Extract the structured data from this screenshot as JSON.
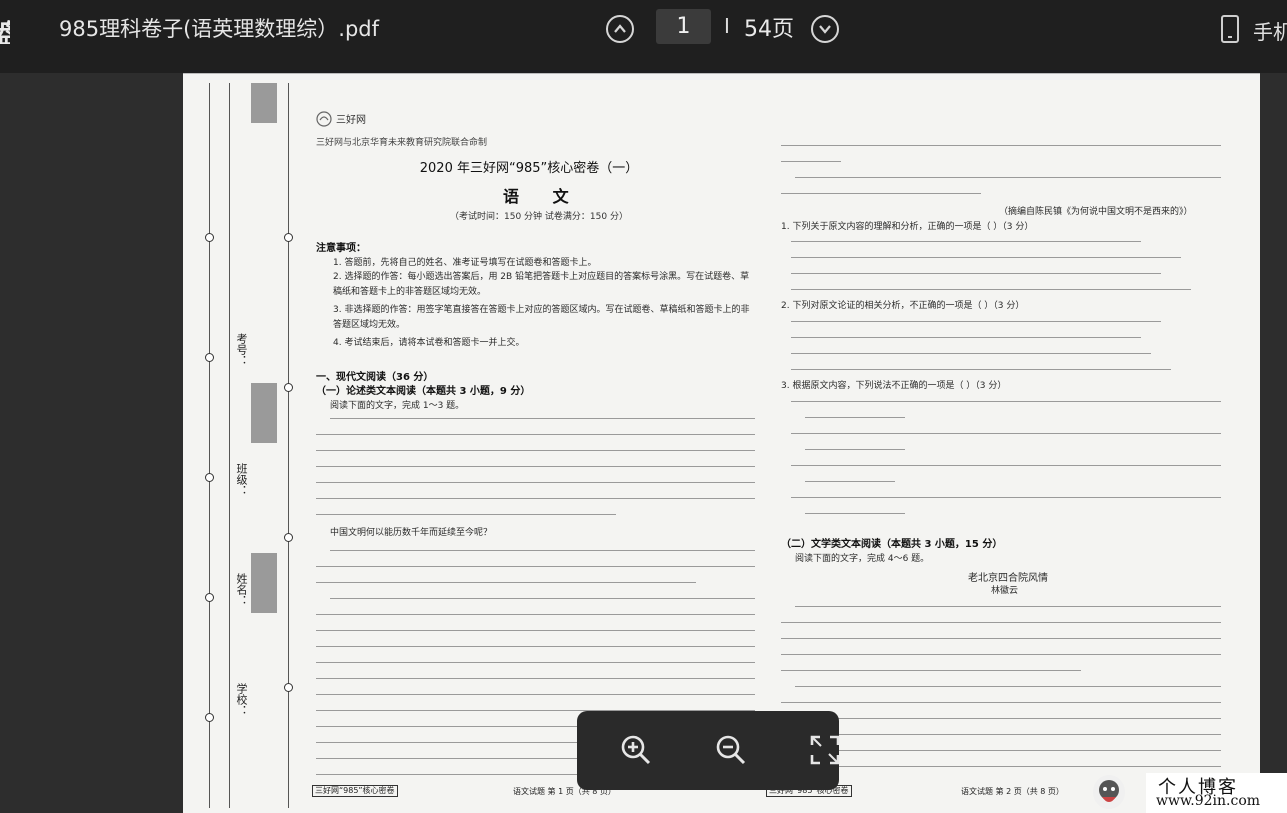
{
  "toolbar": {
    "title": "985理科卷子(语英理数理综）.pdf",
    "current_page": "1",
    "separator": "I",
    "total_pages": "54页",
    "phone_label": "手机",
    "left_glyph": "盘"
  },
  "document": {
    "left_col": {
      "logo_text": "三好网",
      "top_note": "三好网与北京华育未来教育研究院联合命制",
      "title": "2020 年三好网“985”核心密卷（一）",
      "subject": "语 文",
      "exam_info": "（考试时间：150 分钟  试卷满分：150 分）",
      "notice_heading": "注意事项：",
      "notices": [
        "1. 答题前，先将自己的姓名、准考证号填写在试题卷和答题卡上。",
        "2. 选择题的作答：每小题选出答案后，用 2B 铅笔把答题卡上对应题目的答案标号涂黑。写在试题卷、草稿纸和答题卡上的非答题区域均无效。",
        "3. 非选择题的作答：用签字笔直接答在答题卡上对应的答题区域内。写在试题卷、草稿纸和答题卡上的非答题区域均无效。",
        "4. 考试结束后，请将本试卷和答题卡一并上交。"
      ],
      "section_heading": "一、现代文阅读（36 分）",
      "subsection_heading": "（一）论述类文本阅读（本题共 3 小题，9 分）",
      "instruction": "阅读下面的文字，完成 1～3 题。",
      "paragraph_lead": "中国文明何以能历数千年而延续至今呢？",
      "footer_box": "三好网“985”核心密卷",
      "footer_page": "语文试题  第 1 页（共 8 页）"
    },
    "right_col": {
      "note_tail": "（摘编自陈民镇《为何说中国文明不是西来的》）",
      "q1": "1. 下列关于原文内容的理解和分析，正确的一项是（    ）（3 分）",
      "q2": "2. 下列对原文论证的相关分析，不正确的一项是（    ）（3 分）",
      "q3": "3. 根据原文内容，下列说法不正确的一项是（    ）（3 分）",
      "subsection2_heading": "（二）文学类文本阅读（本题共 3 小题，15 分）",
      "instruction2": "阅读下面的文字，完成 4～6 题。",
      "story_title": "老北京四合院风情",
      "story_author": "林徽云",
      "footer_box": "三好网“985”核心密卷",
      "footer_page": "语文试题  第 2 页（共 8 页）"
    },
    "margin": {
      "labels": [
        "考号：",
        "班级：",
        "姓名：",
        "学校："
      ]
    }
  },
  "zoom_controls": {
    "zoom_in": "zoom-in",
    "zoom_out": "zoom-out",
    "fullscreen": "fullscreen"
  },
  "watermark": {
    "line1": "个人博客",
    "line2": "www.92in.com"
  }
}
